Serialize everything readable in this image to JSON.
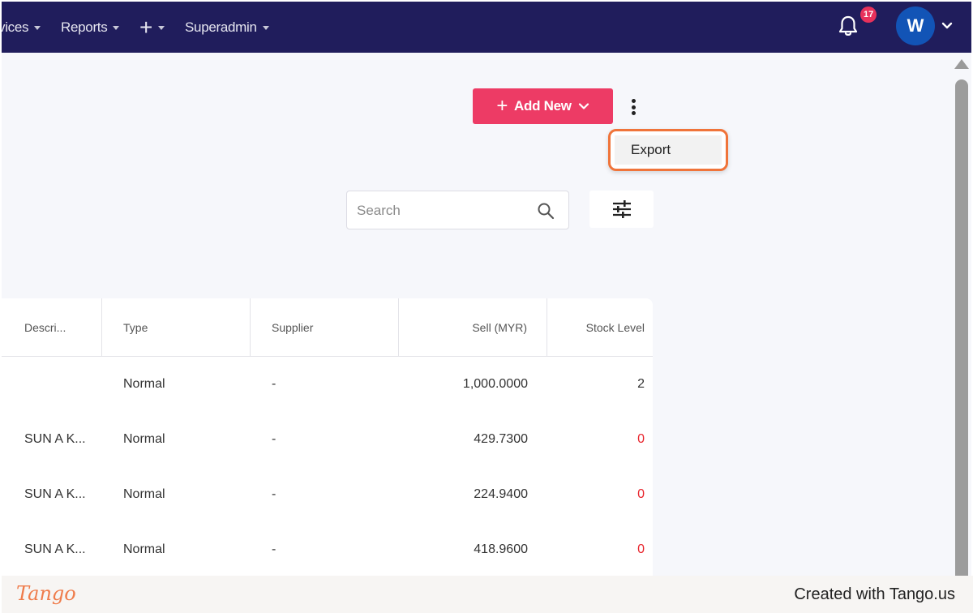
{
  "nav": {
    "items": [
      {
        "label": "vices"
      },
      {
        "label": "Reports"
      },
      {
        "label": "+"
      },
      {
        "label": "Superadmin"
      }
    ],
    "notification_count": "17",
    "avatar_initial": "W"
  },
  "toolbar": {
    "add_new_label": "Add New",
    "export_label": "Export"
  },
  "search": {
    "placeholder": "Search"
  },
  "table": {
    "headers": [
      "Descri...",
      "Type",
      "Supplier",
      "Sell (MYR)",
      "Stock Level"
    ],
    "rows": [
      [
        "",
        "Normal",
        "-",
        "1,000.0000",
        "2"
      ],
      [
        "SUN A K...",
        "Normal",
        "-",
        "429.7300",
        "0"
      ],
      [
        "SUN A K...",
        "Normal",
        "-",
        "224.9400",
        "0"
      ],
      [
        "SUN A K...",
        "Normal",
        "-",
        "418.9600",
        "0"
      ]
    ]
  },
  "colors": {
    "nav_bg": "#201d5c",
    "accent": "#ed3b65",
    "highlight": "#f0743a",
    "avatar": "#1254b6",
    "zero_stock": "#e8242c"
  },
  "footer": {
    "logo": "Tango",
    "credit": "Created with Tango.us"
  }
}
